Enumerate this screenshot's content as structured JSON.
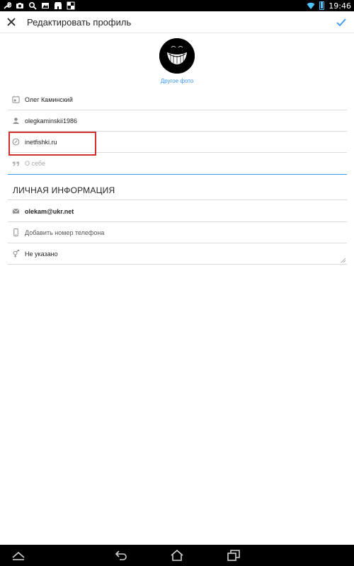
{
  "status_bar": {
    "time": "19:46",
    "left_icons": [
      "wrench-icon",
      "camera-icon",
      "search-icon",
      "image-icon",
      "shop-icon",
      "chess-icon"
    ],
    "accent_color": "#4fc3f7"
  },
  "header": {
    "title": "Редактировать профиль",
    "close_icon": "close-icon",
    "confirm_icon": "check-icon",
    "accent_color": "#3897f0"
  },
  "avatar": {
    "change_photo_label": "Другое фото"
  },
  "profile_fields": [
    {
      "icon": "profile-card-icon",
      "value": "Олег Каминский"
    },
    {
      "icon": "user-icon",
      "value": "olegkaminskii1986"
    },
    {
      "icon": "link-icon",
      "value": "inetfishki.ru"
    },
    {
      "icon": "quote-icon",
      "placeholder": "О себе"
    }
  ],
  "personal_info": {
    "title": "ЛИЧНАЯ ИНФОРМАЦИЯ",
    "fields": [
      {
        "icon": "mail-icon",
        "value": "olekam@ukr.net"
      },
      {
        "icon": "phone-icon",
        "value": "Добавить номер телефона"
      },
      {
        "icon": "gender-icon",
        "value": "Не указано"
      }
    ]
  },
  "nav_bar": {
    "buttons": [
      "menu-up-icon",
      "back-icon",
      "home-icon",
      "recent-apps-icon"
    ]
  },
  "highlight_color": "#d32f2f"
}
